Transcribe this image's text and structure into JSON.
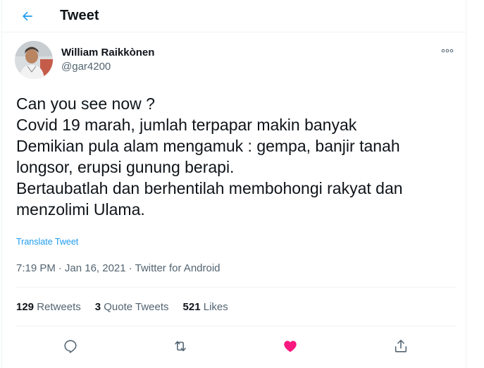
{
  "header": {
    "title": "Tweet",
    "back_icon": "arrow-left-icon"
  },
  "author": {
    "display_name": "William Raikkònen",
    "handle": "@gar4200"
  },
  "tweet": {
    "text": "Can you see now ?\nCovid 19 marah, jumlah terpapar makin banyak\nDemikian pula alam mengamuk : gempa, banjir tanah longsor, erupsi gunung berapi.\nBertaubatlah dan berhentilah membohongi rakyat dan menzolimi Ulama.",
    "translate_label": "Translate Tweet",
    "time": "7:19 PM",
    "separator1": "·",
    "date": "Jan 16, 2021",
    "separator2": "·",
    "source": "Twitter for Android"
  },
  "stats": {
    "retweets_count": "129",
    "retweets_label": "Retweets",
    "quotes_count": "3",
    "quotes_label": "Quote Tweets",
    "likes_count": "521",
    "likes_label": "Likes"
  },
  "actions": [
    "reply-icon",
    "retweet-icon",
    "like-icon",
    "share-icon"
  ],
  "colors": {
    "accent": "#1d9bf0",
    "like": "#f91880",
    "muted": "#536471",
    "text": "#0f1419",
    "divider": "#eff3f4"
  }
}
